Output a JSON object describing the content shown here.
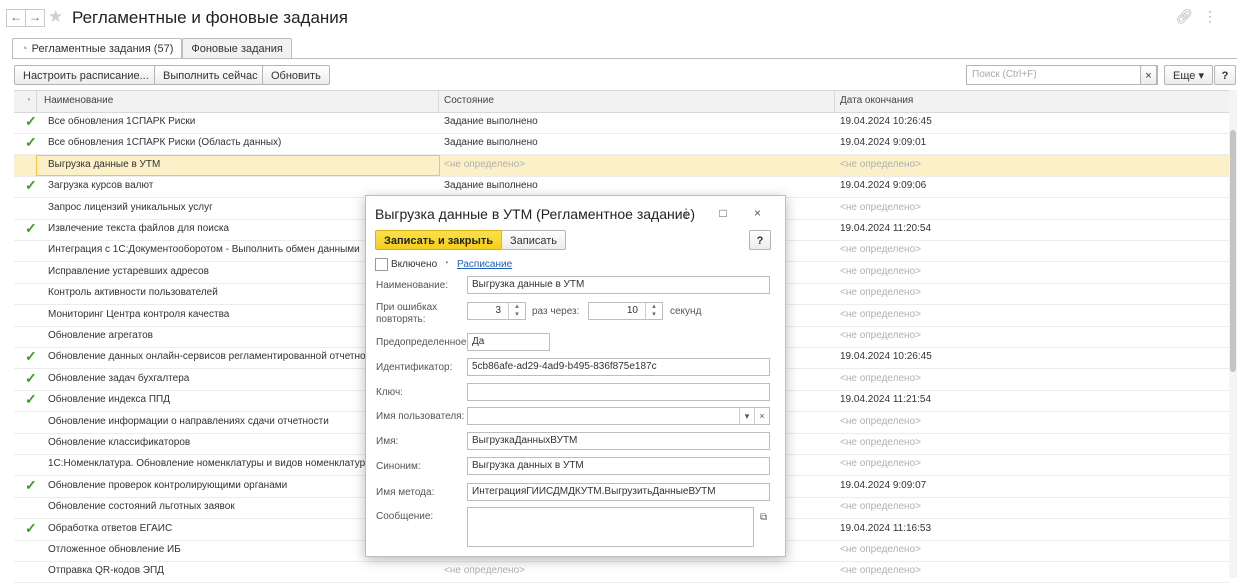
{
  "window": {
    "title": "Регламентные и фоновые задания",
    "back_glyph": "←",
    "forward_glyph": "→",
    "star_glyph": "★",
    "link_glyph": "🔗",
    "menu_glyph": "⋮"
  },
  "tabs": [
    {
      "label": "Регламентные задания (57)",
      "active": true
    },
    {
      "label": "Фоновые задания",
      "active": false
    }
  ],
  "toolbar": {
    "configure_label": "Настроить расписание...",
    "run_label": "Выполнить сейчас",
    "refresh_label": "Обновить",
    "search_placeholder": "Поиск (Ctrl+F)",
    "search_clear": "×",
    "more_label": "Еще ▾",
    "help_label": "?"
  },
  "table": {
    "headers": {
      "name": "Наименование",
      "state": "Состояние",
      "end": "Дата окончания"
    },
    "rows": [
      {
        "check": "✓",
        "name": "Все обновления 1СПАРК Риски",
        "state": "Задание выполнено",
        "end": "19.04.2024 10:26:45"
      },
      {
        "check": "✓",
        "name": "Все обновления 1СПАРК Риски (Область данных)",
        "state": "Задание выполнено",
        "end": "19.04.2024 9:09:01"
      },
      {
        "check": "",
        "name": "Выгрузка данные в УТМ",
        "state": "<не определено>",
        "end": "<не определено>"
      },
      {
        "check": "✓",
        "name": "Загрузка курсов валют",
        "state": "Задание выполнено",
        "end": "19.04.2024 9:09:06"
      },
      {
        "check": "",
        "name": "Запрос лицензий уникальных услуг",
        "state": "",
        "end": "<не определено>"
      },
      {
        "check": "✓",
        "name": "Извлечение текста файлов для поиска",
        "state": "",
        "end": "19.04.2024 11:20:54"
      },
      {
        "check": "",
        "name": "Интеграция с 1С:Документооборотом - Выполнить обмен данными",
        "state": "",
        "end": "<не определено>"
      },
      {
        "check": "",
        "name": "Исправление устаревших адресов",
        "state": "",
        "end": "<не определено>"
      },
      {
        "check": "",
        "name": "Контроль активности пользователей",
        "state": "",
        "end": "<не определено>"
      },
      {
        "check": "",
        "name": "Мониторинг Центра контроля качества",
        "state": "",
        "end": "<не определено>"
      },
      {
        "check": "",
        "name": "Обновление агрегатов",
        "state": "",
        "end": "<не определено>"
      },
      {
        "check": "✓",
        "name": "Обновление данных онлайн-сервисов регламентированной отчетности",
        "state": "",
        "end": "19.04.2024 10:26:45"
      },
      {
        "check": "✓",
        "name": "Обновление задач бухгалтера",
        "state": "",
        "end": "<не определено>"
      },
      {
        "check": "✓",
        "name": "Обновление индекса ППД",
        "state": "",
        "end": "19.04.2024 11:21:54"
      },
      {
        "check": "",
        "name": "Обновление информации о направлениях сдачи отчетности",
        "state": "",
        "end": "<не определено>"
      },
      {
        "check": "",
        "name": "Обновление классификаторов",
        "state": "",
        "end": "<не определено>"
      },
      {
        "check": "",
        "name": "1С:Номенклатура. Обновление номенклатуры и видов номенклатуры",
        "state": "",
        "end": "<не определено>"
      },
      {
        "check": "✓",
        "name": "Обновление проверок контролирующими органами",
        "state": "",
        "end": "19.04.2024 9:09:07"
      },
      {
        "check": "",
        "name": "Обновление состояний льготных заявок",
        "state": "",
        "end": "<не определено>"
      },
      {
        "check": "✓",
        "name": "Обработка ответов ЕГАИС",
        "state": "",
        "end": "19.04.2024 11:16:53"
      },
      {
        "check": "",
        "name": "Отложенное обновление ИБ",
        "state": "",
        "end": "<не определено>"
      },
      {
        "check": "",
        "name": "Отправка QR-кодов ЭПД",
        "state": "<не определено>",
        "end": "<не определено>"
      }
    ]
  },
  "dialog": {
    "title": "Выгрузка данные в УТМ (Регламентное задание)",
    "icons": "⋮ □ ×",
    "save_close_label": "Записать и закрыть",
    "save_label": "Записать",
    "help_label": "?",
    "enabled_label": "Включено",
    "schedule_label": "Расписание",
    "name_label": "Наименование:",
    "name_value": "Выгрузка данные в УТМ",
    "retry_label_1": "При ошибках",
    "retry_label_2": "повторять:",
    "retry_count": "3",
    "retry_times_label": "раз через:",
    "retry_interval": "10",
    "seconds_label": "секунд",
    "predefined_label": "Предопределенное:",
    "predefined_value": "Да",
    "id_label": "Идентификатор:",
    "id_value": "5cb86afe-ad29-4ad9-b495-836f875e187c",
    "key_label": "Ключ:",
    "key_value": "",
    "user_label": "Имя пользователя:",
    "user_value": "",
    "name2_label": "Имя:",
    "name2_value": "ВыгрузкаДанныхВУТМ",
    "synonym_label": "Синоним:",
    "synonym_value": "Выгрузка данных в УТМ",
    "method_label": "Имя метода:",
    "method_value": "ИнтеграцияГИИСДМДКУТМ.ВыгрузитьДанныеВУТМ",
    "message_label": "Сообщение:",
    "message_value": ""
  },
  "colors": {
    "accent": "#f5cf1e",
    "check": "#3e9b2b",
    "selected_row": "#fbf0c7",
    "link": "#2261b5"
  }
}
